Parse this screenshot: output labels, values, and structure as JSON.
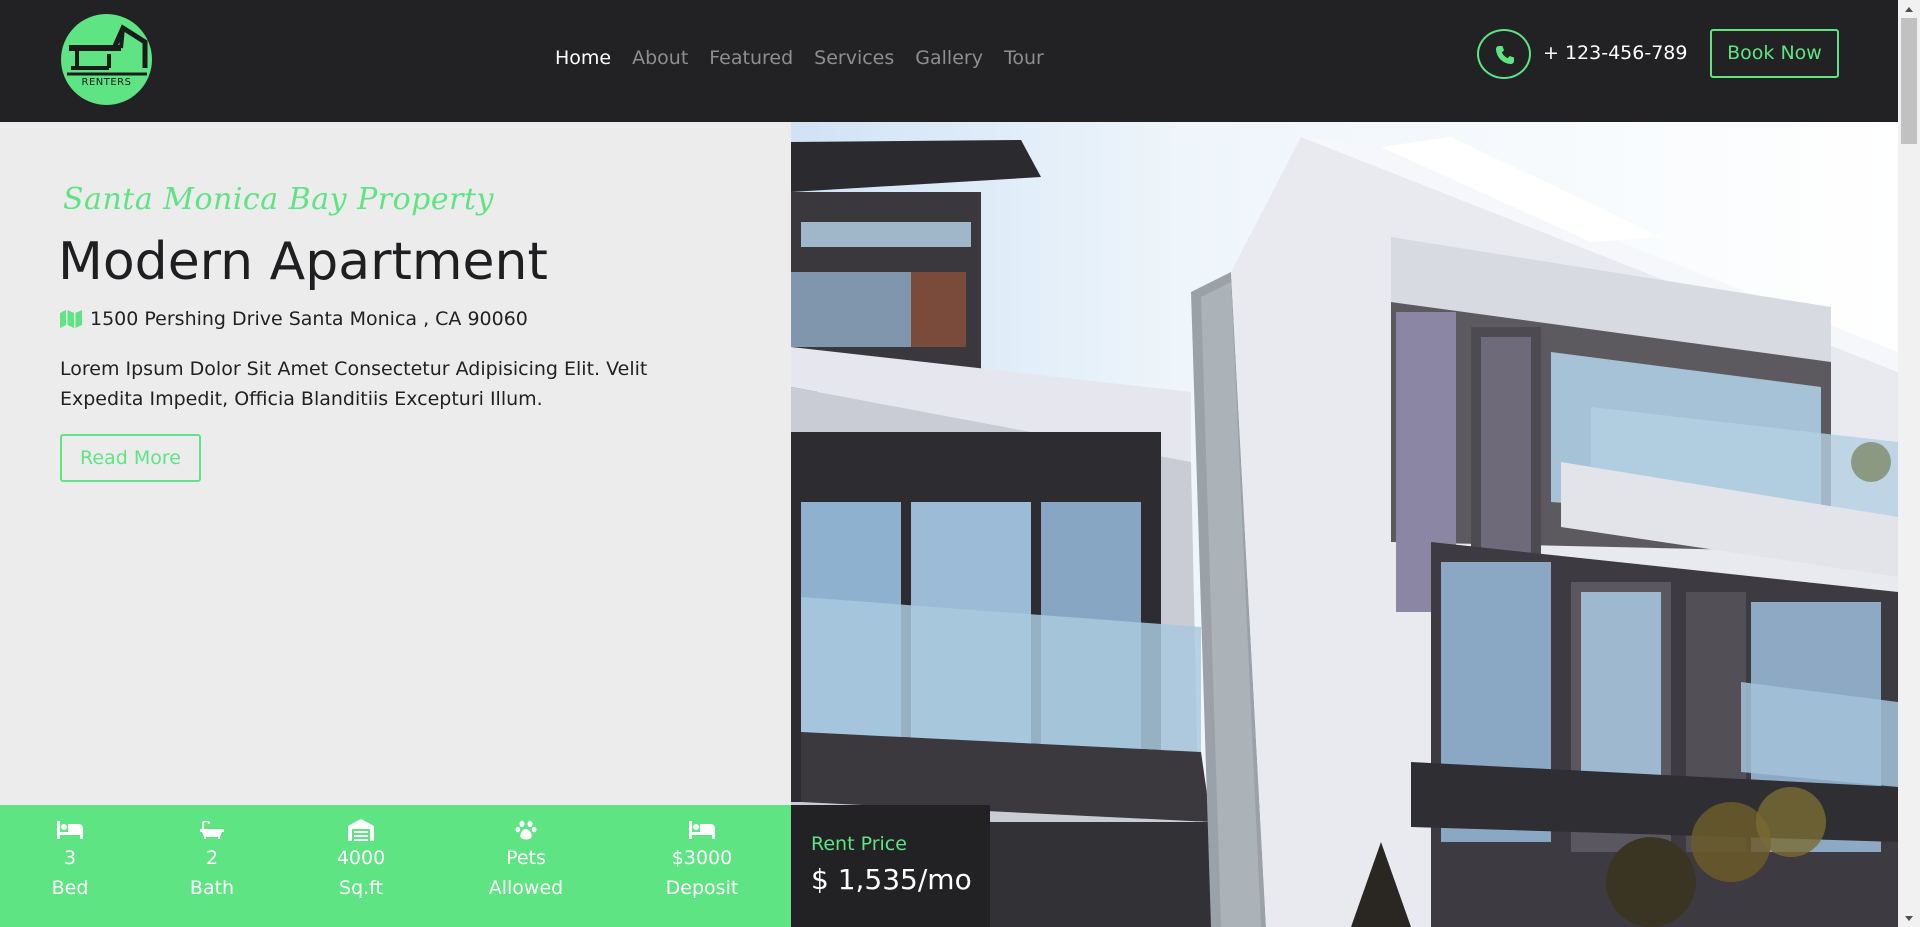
{
  "logo": {
    "text": "RENTERS"
  },
  "nav": {
    "items": [
      "Home",
      "About",
      "Featured",
      "Services",
      "Gallery",
      "Tour"
    ]
  },
  "contact": {
    "phone": "+ 123-456-789",
    "icon": "phone-icon"
  },
  "header": {
    "book_label": "Book Now"
  },
  "hero": {
    "subtitle": "Santa Monica Bay Property",
    "title": "Modern Apartment",
    "address": "1500 Pershing Drive Santa Monica , CA 90060",
    "description": "Lorem Ipsum Dolor Sit Amet Consectetur Adipisicing Elit. Velit Expedita Impedit, Officia Blanditiis Excepturi Illum.",
    "read_more": "Read More"
  },
  "features": [
    {
      "value": "3",
      "label": "Bed",
      "icon": "bed-icon"
    },
    {
      "value": "2",
      "label": "Bath",
      "icon": "bath-icon"
    },
    {
      "value": "4000",
      "label": "Sq.ft",
      "icon": "warehouse-icon"
    },
    {
      "value": "Pets",
      "label": "Allowed",
      "icon": "paw-icon"
    },
    {
      "value": "$3000",
      "label": "Deposit",
      "icon": "bed-icon"
    }
  ],
  "rent": {
    "label": "Rent Price",
    "value": "$ 1,535/mo"
  },
  "colors": {
    "accent": "#5ee483",
    "dark": "#222224",
    "light_bg": "#ececec"
  }
}
